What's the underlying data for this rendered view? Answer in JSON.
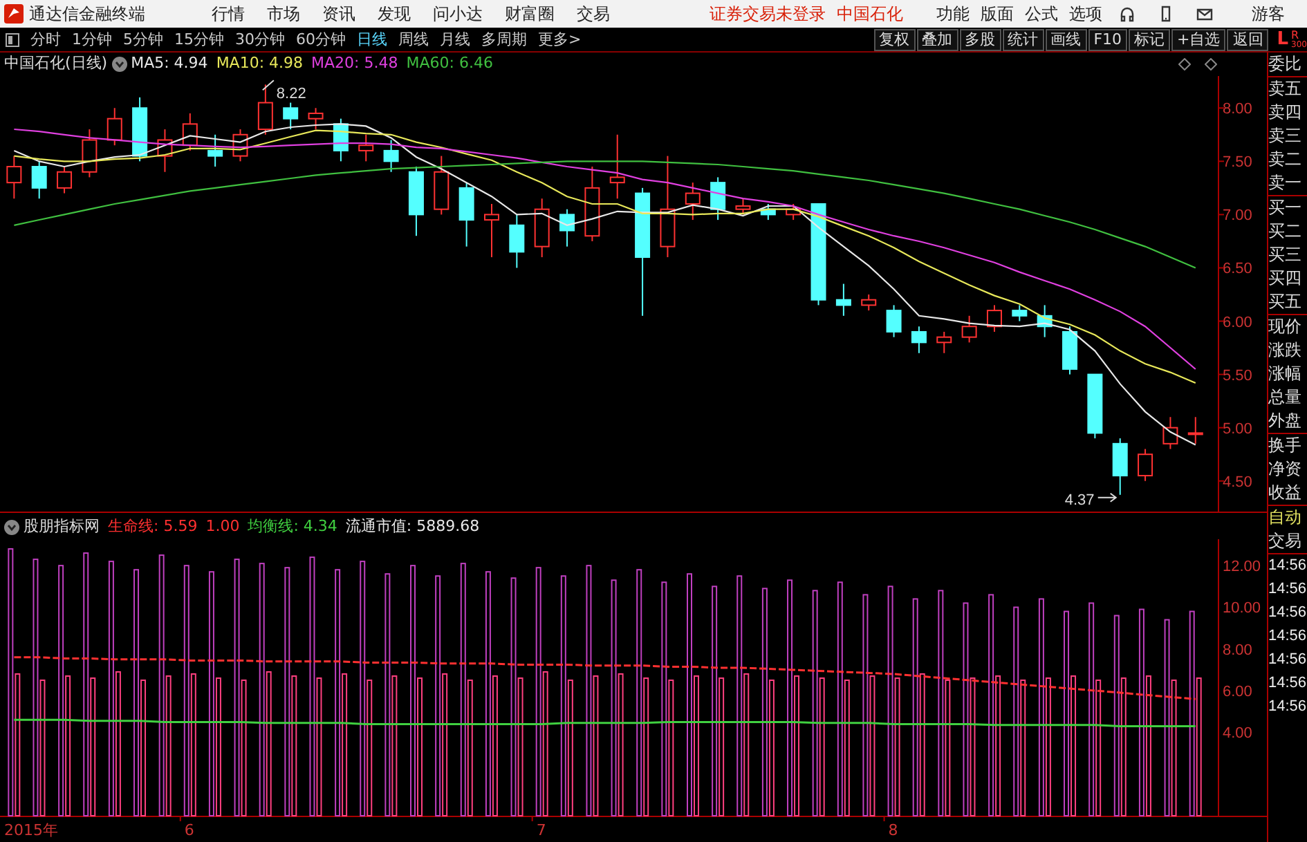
{
  "menu_bar": {
    "app_title": "通达信金融终端",
    "menus": [
      "行情",
      "市场",
      "资讯",
      "发现",
      "问小达",
      "财富圈",
      "交易"
    ],
    "notices": [
      "证券交易未登录",
      "中国石化"
    ],
    "right_menus": [
      "功能",
      "版面",
      "公式",
      "选项"
    ],
    "user": "游客"
  },
  "period_bar": {
    "periods": [
      {
        "label": "分时",
        "selected": false
      },
      {
        "label": "1分钟",
        "selected": false
      },
      {
        "label": "5分钟",
        "selected": false
      },
      {
        "label": "15分钟",
        "selected": false
      },
      {
        "label": "30分钟",
        "selected": false
      },
      {
        "label": "60分钟",
        "selected": false
      },
      {
        "label": "日线",
        "selected": true
      },
      {
        "label": "周线",
        "selected": false
      },
      {
        "label": "月线",
        "selected": false
      },
      {
        "label": "多周期",
        "selected": false
      },
      {
        "label": "更多>",
        "selected": false
      }
    ],
    "tools": [
      "复权",
      "叠加",
      "多股",
      "统计",
      "画线",
      "F10",
      "标记",
      "+自选",
      "返回"
    ],
    "corner": [
      "L",
      "R",
      "300"
    ]
  },
  "main_chart": {
    "title": "中国石化(日线)",
    "legend": [
      {
        "kind": "series",
        "text": ": 4.94"
      },
      {
        "kind": "series",
        "text": ": 4.98"
      },
      {
        "kind": "series",
        "text": ": 5.48"
      },
      {
        "kind": "series",
        "text": ": 6.46"
      }
    ],
    "chart_data": {
      "type": "candlestick",
      "ylim": [
        4.2,
        8.3
      ],
      "yticks": [
        {
          "value": 8,
          "label": "8.00"
        },
        {
          "value": 7.5,
          "label": "7.50"
        },
        {
          "value": 7,
          "label": "7.00"
        },
        {
          "value": 6.5,
          "label": "6.50"
        },
        {
          "value": 6,
          "label": "6.00"
        },
        {
          "value": 5.5,
          "label": "5.50"
        },
        {
          "value": 5,
          "label": "5.00"
        },
        {
          "value": 4.5,
          "label": "4.50"
        }
      ],
      "ohlc": [
        [
          7.3,
          7.55,
          7.15,
          7.45
        ],
        [
          7.45,
          7.5,
          7.15,
          7.25
        ],
        [
          7.25,
          7.45,
          7.2,
          7.4
        ],
        [
          7.4,
          7.8,
          7.35,
          7.7
        ],
        [
          7.7,
          8.0,
          7.65,
          7.9
        ],
        [
          8.0,
          8.1,
          7.5,
          7.55
        ],
        [
          7.55,
          7.8,
          7.4,
          7.7
        ],
        [
          7.65,
          7.95,
          7.6,
          7.85
        ],
        [
          7.6,
          7.75,
          7.45,
          7.55
        ],
        [
          7.55,
          7.8,
          7.5,
          7.75
        ],
        [
          7.8,
          8.22,
          7.75,
          8.05
        ],
        [
          8.0,
          8.05,
          7.8,
          7.9
        ],
        [
          7.9,
          8.0,
          7.8,
          7.95
        ],
        [
          7.85,
          7.9,
          7.5,
          7.6
        ],
        [
          7.6,
          7.75,
          7.5,
          7.65
        ],
        [
          7.6,
          7.7,
          7.4,
          7.5
        ],
        [
          7.4,
          7.45,
          6.8,
          7.0
        ],
        [
          7.05,
          7.55,
          7.0,
          7.4
        ],
        [
          7.25,
          7.3,
          6.7,
          6.95
        ],
        [
          6.95,
          7.1,
          6.6,
          7.0
        ],
        [
          6.9,
          7.0,
          6.5,
          6.65
        ],
        [
          6.7,
          7.15,
          6.6,
          7.05
        ],
        [
          7.0,
          7.05,
          6.7,
          6.85
        ],
        [
          6.8,
          7.45,
          6.75,
          7.25
        ],
        [
          7.3,
          7.75,
          7.15,
          7.35
        ],
        [
          7.2,
          7.25,
          6.05,
          6.6
        ],
        [
          6.7,
          7.55,
          6.6,
          7.05
        ],
        [
          7.1,
          7.3,
          6.95,
          7.2
        ],
        [
          7.3,
          7.35,
          6.95,
          7.05
        ],
        [
          7.05,
          7.15,
          7.0,
          7.08
        ],
        [
          7.05,
          7.1,
          6.95,
          7.0
        ],
        [
          7.0,
          7.1,
          6.95,
          7.05
        ],
        [
          7.1,
          7.1,
          6.15,
          6.2
        ],
        [
          6.2,
          6.35,
          6.05,
          6.15
        ],
        [
          6.15,
          6.25,
          6.1,
          6.2
        ],
        [
          6.1,
          6.15,
          5.85,
          5.9
        ],
        [
          5.9,
          5.95,
          5.7,
          5.8
        ],
        [
          5.8,
          5.9,
          5.7,
          5.85
        ],
        [
          5.85,
          6.05,
          5.8,
          5.95
        ],
        [
          5.95,
          6.15,
          5.9,
          6.1
        ],
        [
          6.1,
          6.15,
          6.0,
          6.05
        ],
        [
          6.05,
          6.15,
          5.85,
          5.95
        ],
        [
          5.9,
          5.95,
          5.5,
          5.55
        ],
        [
          5.5,
          5.5,
          4.9,
          4.95
        ],
        [
          4.85,
          4.9,
          4.37,
          4.55
        ],
        [
          4.55,
          4.8,
          4.5,
          4.75
        ],
        [
          4.85,
          5.1,
          4.8,
          5.0
        ],
        [
          4.95,
          5.1,
          4.85,
          4.95
        ]
      ],
      "series": [
        {
          "name": "MA5",
          "type": "line",
          "color": "#e8e8e8",
          "values": [
            7.6,
            7.5,
            7.45,
            7.5,
            7.54,
            7.56,
            7.65,
            7.74,
            7.71,
            7.68,
            7.78,
            7.82,
            7.84,
            7.85,
            7.83,
            7.72,
            7.54,
            7.43,
            7.3,
            7.17,
            7.0,
            7.01,
            6.9,
            6.96,
            7.03,
            7.02,
            7.02,
            7.09,
            7.05,
            6.99,
            7.08,
            7.08,
            6.88,
            6.7,
            6.52,
            6.3,
            6.05,
            6.02,
            5.98,
            5.96,
            5.95,
            5.98,
            5.92,
            5.72,
            5.41,
            5.15,
            4.96,
            4.84
          ]
        },
        {
          "name": "MA10",
          "type": "line",
          "color": "#e8e85a",
          "values": [
            7.55,
            7.52,
            7.5,
            7.5,
            7.52,
            7.53,
            7.56,
            7.62,
            7.62,
            7.61,
            7.67,
            7.73,
            7.79,
            7.78,
            7.76,
            7.75,
            7.68,
            7.63,
            7.57,
            7.51,
            7.4,
            7.3,
            7.17,
            7.1,
            7.1,
            7.01,
            7.01,
            7.0,
            7.01,
            7.01,
            7.05,
            7.05,
            6.98,
            6.89,
            6.8,
            6.69,
            6.56,
            6.45,
            6.34,
            6.24,
            6.16,
            6.03,
            5.97,
            5.87,
            5.72,
            5.6,
            5.52,
            5.42
          ]
        },
        {
          "name": "MA20",
          "type": "line",
          "color": "#e040e0",
          "values": [
            7.8,
            7.78,
            7.75,
            7.72,
            7.7,
            7.68,
            7.66,
            7.65,
            7.64,
            7.63,
            7.64,
            7.65,
            7.66,
            7.67,
            7.67,
            7.66,
            7.63,
            7.62,
            7.59,
            7.56,
            7.53,
            7.49,
            7.45,
            7.42,
            7.39,
            7.33,
            7.3,
            7.25,
            7.2,
            7.15,
            7.12,
            7.08,
            7.0,
            6.93,
            6.86,
            6.8,
            6.75,
            6.69,
            6.62,
            6.55,
            6.46,
            6.38,
            6.3,
            6.2,
            6.09,
            5.95,
            5.75,
            5.55
          ]
        },
        {
          "name": "MA60",
          "type": "line",
          "color": "#40c040",
          "values": [
            6.9,
            6.95,
            7.0,
            7.05,
            7.1,
            7.14,
            7.18,
            7.22,
            7.25,
            7.28,
            7.31,
            7.34,
            7.37,
            7.39,
            7.41,
            7.43,
            7.44,
            7.45,
            7.46,
            7.47,
            7.48,
            7.49,
            7.5,
            7.5,
            7.5,
            7.5,
            7.49,
            7.48,
            7.47,
            7.45,
            7.43,
            7.41,
            7.38,
            7.35,
            7.32,
            7.28,
            7.24,
            7.2,
            7.15,
            7.1,
            7.05,
            6.99,
            6.93,
            6.86,
            6.78,
            6.7,
            6.6,
            6.5
          ]
        }
      ],
      "annotations": [
        "8.22",
        "4.37"
      ]
    }
  },
  "indicator": {
    "name": "股朋指标网",
    "legend": [
      {
        "kind": "series",
        "text": ": 5.59"
      },
      {
        "kind": "text",
        "text": "1.00",
        "color": "#ff3030"
      },
      {
        "kind": "series",
        "text": ": 4.34"
      },
      {
        "kind": "text",
        "text": "流通市值: 5889.68",
        "color": "#e8e8e8"
      }
    ],
    "chart_data": {
      "type": "bar",
      "x": [
        5.5,
        5.571,
        5.643,
        5.714,
        5.786,
        5.857,
        5.929,
        6,
        6.071,
        6.143,
        6.214,
        6.286,
        6.357,
        6.429,
        6.5,
        6.571,
        6.643,
        6.714,
        6.786,
        6.857,
        6.929,
        7,
        7.071,
        7.143,
        7.214,
        7.286,
        7.357,
        7.429,
        7.5,
        7.571,
        7.643,
        7.714,
        7.786,
        7.857,
        7.929,
        8,
        8.071,
        8.143,
        8.214,
        8.286,
        8.357,
        8.429,
        8.5,
        8.571,
        8.643,
        8.714,
        8.786,
        8.857
      ],
      "xlim": [
        5.46,
        9.06
      ],
      "ylim": [
        0,
        13
      ],
      "xlabel": "2015年",
      "yticks": [
        {
          "value": 12,
          "label": "12.00"
        },
        {
          "value": 10,
          "label": "10.00"
        },
        {
          "value": 8,
          "label": "8.00"
        },
        {
          "value": 6,
          "label": "6.00"
        },
        {
          "value": 4,
          "label": "4.00"
        }
      ],
      "xticks": [
        6,
        7,
        8
      ],
      "series": [
        {
          "type": "bar",
          "color": "#c040c0",
          "values": [
            12.8,
            12.3,
            12.0,
            12.6,
            12.2,
            11.8,
            12.5,
            12.0,
            11.7,
            12.3,
            12.1,
            11.9,
            12.4,
            11.8,
            12.2,
            11.6,
            12.0,
            11.5,
            12.1,
            11.7,
            11.4,
            11.9,
            11.5,
            12.0,
            11.3,
            11.8,
            11.2,
            11.6,
            11.0,
            11.5,
            10.9,
            11.3,
            10.8,
            11.2,
            10.6,
            11.0,
            10.4,
            10.8,
            10.2,
            10.6,
            10.0,
            10.4,
            9.8,
            10.2,
            9.6,
            9.9,
            9.4,
            9.8
          ]
        },
        {
          "type": "bar",
          "color": "#ff4080",
          "values": [
            6.8,
            6.5,
            6.7,
            6.6,
            6.9,
            6.5,
            6.7,
            6.8,
            6.6,
            6.5,
            6.9,
            6.7,
            6.6,
            6.8,
            6.5,
            6.7,
            6.6,
            6.8,
            6.5,
            6.7,
            6.6,
            6.9,
            6.5,
            6.7,
            6.8,
            6.6,
            6.5,
            6.7,
            6.6,
            6.8,
            6.5,
            6.7,
            6.6,
            6.5,
            6.7,
            6.6,
            6.8,
            6.5,
            6.6,
            6.7,
            6.5,
            6.6,
            6.7,
            6.5,
            6.6,
            6.7,
            6.5,
            6.6
          ]
        },
        {
          "name": "生命线",
          "type": "line",
          "line_style": "dashed",
          "color": "#ff3030",
          "values": [
            7.6,
            7.6,
            7.55,
            7.55,
            7.5,
            7.5,
            7.5,
            7.45,
            7.45,
            7.45,
            7.4,
            7.4,
            7.4,
            7.4,
            7.35,
            7.35,
            7.35,
            7.3,
            7.3,
            7.3,
            7.25,
            7.25,
            7.25,
            7.2,
            7.2,
            7.2,
            7.15,
            7.15,
            7.1,
            7.1,
            7.05,
            7.0,
            6.95,
            6.9,
            6.85,
            6.8,
            6.7,
            6.6,
            6.5,
            6.4,
            6.3,
            6.2,
            6.1,
            6.0,
            5.9,
            5.8,
            5.7,
            5.6
          ]
        },
        {
          "name": "均衡线",
          "type": "line",
          "color": "#40d040",
          "values": [
            4.6,
            4.6,
            4.6,
            4.55,
            4.55,
            4.55,
            4.5,
            4.5,
            4.5,
            4.5,
            4.45,
            4.45,
            4.45,
            4.45,
            4.4,
            4.4,
            4.4,
            4.4,
            4.4,
            4.4,
            4.4,
            4.4,
            4.45,
            4.45,
            4.45,
            4.45,
            4.5,
            4.5,
            4.5,
            4.5,
            4.5,
            4.5,
            4.45,
            4.45,
            4.45,
            4.4,
            4.4,
            4.4,
            4.4,
            4.35,
            4.35,
            4.35,
            4.35,
            4.35,
            4.3,
            4.3,
            4.3,
            4.3
          ]
        }
      ]
    }
  },
  "quote_panel": {
    "groups": [
      [
        {
          "label": "委比",
          "accent": false
        }
      ],
      [
        {
          "label": "卖五",
          "accent": false
        },
        {
          "label": "卖四",
          "accent": false
        },
        {
          "label": "卖三",
          "accent": false
        },
        {
          "label": "卖二",
          "accent": false
        },
        {
          "label": "卖一",
          "accent": false
        }
      ],
      [
        {
          "label": "买一",
          "accent": false
        },
        {
          "label": "买二",
          "accent": false
        },
        {
          "label": "买三",
          "accent": false
        },
        {
          "label": "买四",
          "accent": false
        },
        {
          "label": "买五",
          "accent": false
        }
      ],
      [
        {
          "label": "现价",
          "accent": false
        },
        {
          "label": "涨跌",
          "accent": false
        },
        {
          "label": "涨幅",
          "accent": false
        },
        {
          "label": "总量",
          "accent": false
        },
        {
          "label": "外盘",
          "accent": false
        }
      ],
      [
        {
          "label": "换手",
          "accent": false
        },
        {
          "label": "净资",
          "accent": false
        },
        {
          "label": "收益",
          "accent": false
        }
      ],
      [
        {
          "label": "自动",
          "accent": true
        },
        {
          "label": "交易",
          "accent": false
        }
      ]
    ],
    "times": [
      "14:56",
      "14:56",
      "14:56",
      "14:56",
      "14:56",
      "14:56",
      "14:56"
    ]
  }
}
